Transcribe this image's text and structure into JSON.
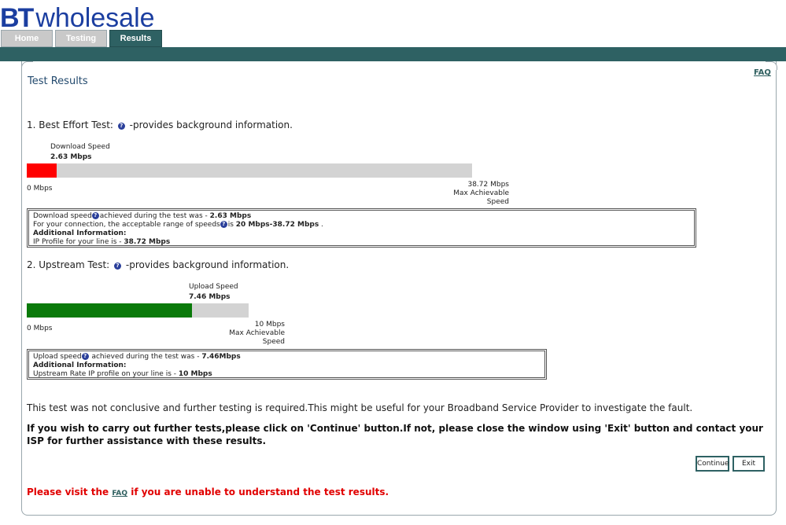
{
  "brand": {
    "bt": "BT",
    "wholesale": "wholesale"
  },
  "tabs": [
    {
      "label": "Home",
      "active": false
    },
    {
      "label": "Testing",
      "active": false
    },
    {
      "label": "Results",
      "active": true
    }
  ],
  "faq_link": "FAQ",
  "page_title": "Test Results",
  "best_effort": {
    "heading_prefix": "1. Best Effort Test:",
    "heading_suffix": "-provides background information.",
    "bar_label": "Download Speed",
    "bar_value": "2.63 Mbps",
    "measured_mbps": 2.63,
    "max_mbps": 38.72,
    "min_label": "0 Mbps",
    "max_label": "38.72 Mbps",
    "max_caption": "Max Achievable Speed",
    "fill_color": "#ff0000",
    "info": {
      "line1_a": "Download speed",
      "line1_b": "achieved during the test was - ",
      "line1_val": "2.63 Mbps",
      "line2_a": "For your connection, the acceptable range of speeds",
      "line2_b": "is ",
      "line2_val": "20 Mbps-38.72 Mbps",
      "line2_end": " .",
      "line3": "Additional Information:",
      "line4_a": "IP Profile for your line is - ",
      "line4_val": "38.72 Mbps"
    }
  },
  "upstream": {
    "heading_prefix": "2. Upstream Test:",
    "heading_suffix": "-provides background information.",
    "bar_label": "Upload Speed",
    "bar_value": "7.46 Mbps",
    "measured_mbps": 7.46,
    "max_mbps": 10,
    "min_label": "0 Mbps",
    "max_label": "10 Mbps",
    "max_caption": "Max Achievable Speed",
    "fill_color": "#0a7a0a",
    "info": {
      "line1_a": "Upload speed",
      "line1_b": " achieved during the test was - ",
      "line1_val": "7.46Mbps",
      "line2": "Additional Information:",
      "line3_a": "Upstream Rate IP profile on your line is - ",
      "line3_val": "10 Mbps"
    }
  },
  "conclusion": "This test was not conclusive and further testing is required.This might be useful for your Broadband Service Provider to investigate the fault.",
  "instructions": "If you wish to carry out further tests,please click on 'Continue' button.If not, please close the window using 'Exit' button and contact your ISP for further assistance with these results.",
  "buttons": {
    "continue": "Continue",
    "exit": "Exit"
  },
  "visit": {
    "before": "Please visit the ",
    "link": "FAQ",
    "after": " if you are unable to understand the test results."
  },
  "colors": {
    "header_bar": "#2e6163",
    "brand_blue": "#1b3ea0",
    "warning_red": "#e10000"
  }
}
